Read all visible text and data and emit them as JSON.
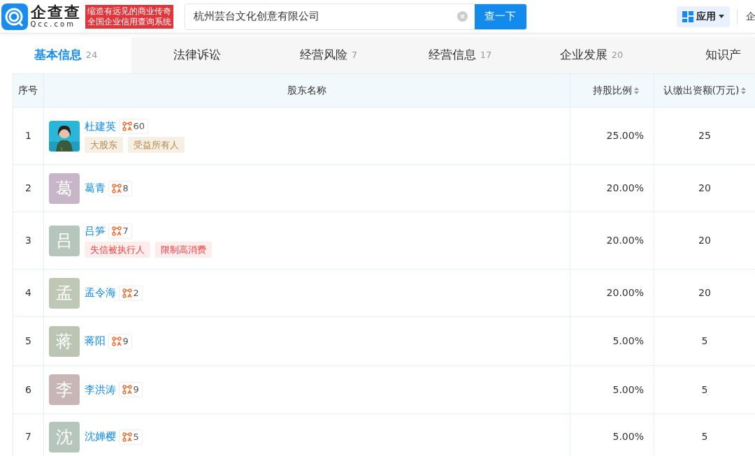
{
  "header": {
    "logo_text": "企查查",
    "logo_domain": "Qcc.com",
    "slogan": [
      "缩造有远见的商业传奇",
      "全国企业信用查询系统"
    ],
    "search": {
      "value": "杭州芸台文化创意有限公司",
      "button": "查一下"
    },
    "apps_button": "应用",
    "cut_link": "企"
  },
  "tabs": [
    {
      "label": "基本信息",
      "count": "24",
      "selected": true
    },
    {
      "label": "法律诉讼",
      "selected": false
    },
    {
      "label": "经营风险",
      "count": "7",
      "selected": false
    },
    {
      "label": "经营信息",
      "count": "17",
      "selected": false
    },
    {
      "label": "企业发展",
      "count": "20",
      "selected": false
    },
    {
      "label": "知识产",
      "selected": false
    }
  ],
  "table": {
    "columns": [
      {
        "label": "序号",
        "sortable": false
      },
      {
        "label": "股东名称",
        "sortable": false
      },
      {
        "label": "持股比例",
        "sortable": true
      },
      {
        "label": "认缴出资额(万元)",
        "sortable": true
      }
    ],
    "rows": [
      {
        "index": "1",
        "name": "杜建英",
        "relations": "60",
        "tags": [
          {
            "label": "大股东",
            "kind": "info"
          },
          {
            "label": "受益所有人",
            "kind": "info"
          }
        ],
        "ratio": "25.00%",
        "amount": "25"
      },
      {
        "index": "2",
        "avatar": {
          "kind": "letter",
          "letter": "葛",
          "color": "#c6b6c7"
        },
        "name": "葛青",
        "relations": "8",
        "ratio": "20.00%",
        "amount": "20"
      },
      {
        "index": "3",
        "avatar": {
          "kind": "letter",
          "letter": "吕",
          "color": "#b6c6bd"
        },
        "name": "吕笋",
        "relations": "7",
        "tags": [
          {
            "label": "失信被执行人",
            "kind": "risk"
          },
          {
            "label": "限制高消费",
            "kind": "risk"
          }
        ],
        "ratio": "20.00%",
        "amount": "20"
      },
      {
        "index": "4",
        "avatar": {
          "kind": "letter",
          "letter": "孟",
          "color": "#bfc7b5"
        },
        "name": "孟令海",
        "relations": "2",
        "ratio": "20.00%",
        "amount": "20"
      },
      {
        "index": "5",
        "avatar": {
          "kind": "letter",
          "letter": "蒋",
          "color": "#bcc5b3"
        },
        "name": "蒋阳",
        "relations": "9",
        "ratio": "5.00%",
        "amount": "5"
      },
      {
        "index": "6",
        "avatar": {
          "kind": "letter",
          "letter": "李",
          "color": "#c8b6b6"
        },
        "name": "李洪涛",
        "relations": "9",
        "ratio": "5.00%",
        "amount": "5"
      },
      {
        "index": "7",
        "avatar": {
          "kind": "letter",
          "letter": "沈",
          "color": "#b6c6bd"
        },
        "name": "沈婵樱",
        "relations": "5",
        "ratio": "5.00%",
        "amount": "5"
      }
    ]
  }
}
